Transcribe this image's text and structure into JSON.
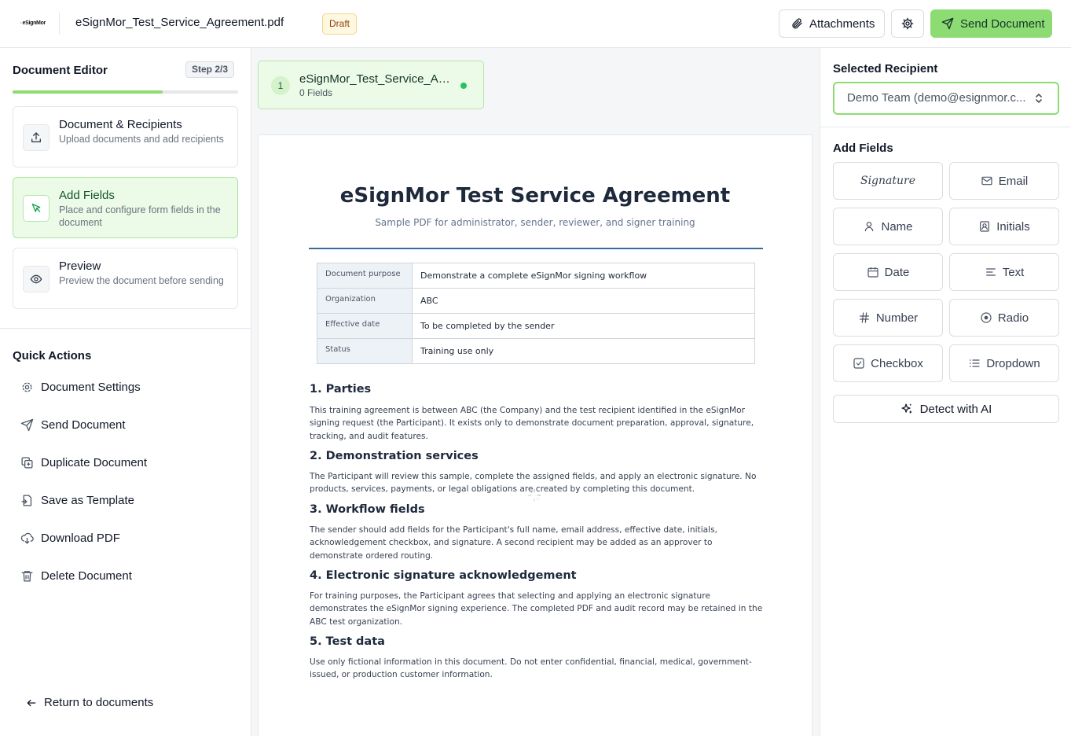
{
  "header": {
    "logo_text": "eSignMor",
    "document_name": "eSignMor_Test_Service_Agreement.pdf",
    "status_badge": "Draft",
    "attachments_label": "Attachments",
    "send_label": "Send Document"
  },
  "sidebar": {
    "title": "Document Editor",
    "step_badge": "Step 2/3",
    "progress_fraction": 0.667,
    "steps": [
      {
        "title": "Document & Recipients",
        "desc": "Upload documents and add recipients",
        "icon": "upload-icon"
      },
      {
        "title": "Add Fields",
        "desc": "Place and configure form fields in the document",
        "icon": "cursor-click-icon",
        "active": true
      },
      {
        "title": "Preview",
        "desc": "Preview the document before sending",
        "icon": "eye-icon"
      }
    ],
    "quick_actions_title": "Quick Actions",
    "quick_actions": [
      {
        "label": "Document Settings",
        "icon": "gear-icon"
      },
      {
        "label": "Send Document",
        "icon": "send-icon"
      },
      {
        "label": "Duplicate Document",
        "icon": "duplicate-icon"
      },
      {
        "label": "Save as Template",
        "icon": "template-icon"
      },
      {
        "label": "Download PDF",
        "icon": "cloud-download-icon"
      },
      {
        "label": "Delete Document",
        "icon": "trash-icon"
      }
    ],
    "return_label": "Return to documents"
  },
  "document_tab": {
    "number": "1",
    "name": "eSignMor_Test_Service_Agreement.pdf",
    "fields": "0 Fields"
  },
  "pdf": {
    "title": "eSignMor Test Service Agreement",
    "subtitle": "Sample PDF for administrator, sender, reviewer, and signer training",
    "table": [
      {
        "k": "Document purpose",
        "v": "Demonstrate a complete eSignMor signing workflow"
      },
      {
        "k": "Organization",
        "v": "ABC"
      },
      {
        "k": "Effective date",
        "v": "To be completed by the sender"
      },
      {
        "k": "Status",
        "v": "Training use only"
      }
    ],
    "sections": [
      {
        "h": "1. Parties",
        "p": "This training agreement is between ABC (the Company) and the test recipient identified in the eSignMor signing request (the Participant). It exists only to demonstrate document preparation, approval, signature, tracking, and audit features."
      },
      {
        "h": "2. Demonstration services",
        "p": "The Participant will review this sample, complete the assigned fields, and apply an electronic signature. No products, services, payments, or legal obligations are created by completing this document."
      },
      {
        "h": "3. Workflow fields",
        "p": "The sender should add fields for the Participant's full name, email address, effective date, initials, acknowledgement checkbox, and signature. A second recipient may be added as an approver to demonstrate ordered routing."
      },
      {
        "h": "4. Electronic signature acknowledgement",
        "p": "For training purposes, the Participant agrees that selecting and applying an electronic signature demonstrates the eSignMor signing experience. The completed PDF and audit record may be retained in the ABC test organization."
      },
      {
        "h": "5. Test data",
        "p": "Use only fictional information in this document. Do not enter confidential, financial, medical, government-issued, or production customer information."
      }
    ]
  },
  "right_panel": {
    "selected_recipient_title": "Selected Recipient",
    "recipient_value": "Demo Team (demo@esignmor.c...",
    "add_fields_title": "Add Fields",
    "fields": [
      {
        "label": "Signature",
        "icon": "signature-icon"
      },
      {
        "label": "Email",
        "icon": "mail-icon"
      },
      {
        "label": "Name",
        "icon": "user-icon"
      },
      {
        "label": "Initials",
        "icon": "initials-icon"
      },
      {
        "label": "Date",
        "icon": "calendar-icon"
      },
      {
        "label": "Text",
        "icon": "text-icon"
      },
      {
        "label": "Number",
        "icon": "hash-icon"
      },
      {
        "label": "Radio",
        "icon": "radio-icon"
      },
      {
        "label": "Checkbox",
        "icon": "checkbox-icon"
      },
      {
        "label": "Dropdown",
        "icon": "list-icon"
      }
    ],
    "detect_label": "Detect with AI"
  },
  "colors": {
    "accent": "#8ddc73",
    "accent_light": "#ecfbe7",
    "draft_bg": "#fef8e1"
  }
}
